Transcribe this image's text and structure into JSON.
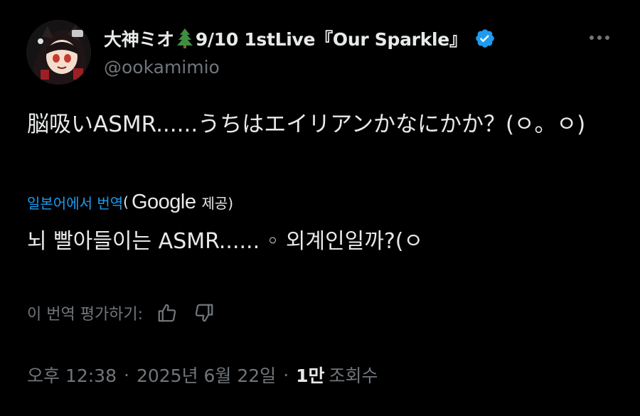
{
  "author": {
    "display_name_prefix": "大神ミオ",
    "tree_icon": "christmas-tree-icon",
    "display_name_suffix": "9/10 1stLive『Our Sparkle』",
    "verified_icon": "verified-badge-icon",
    "handle": "@ookamimio"
  },
  "more_icon": "more-horizontal-icon",
  "tweet": {
    "text": "脳吸いASMR......うちはエイリアンかなにかか？(ㅇ。ㅇ)"
  },
  "translation": {
    "link_label": "일본어에서 번역",
    "open_paren": "(",
    "provider": "Google",
    "provided_label": "제공)",
    "text": "뇌 빨아들이는 ASMR......  ◦  외계인일까?(ㅇ"
  },
  "rating": {
    "label": "이 번역 평가하기:",
    "like_icon": "thumbs-up-icon",
    "dislike_icon": "thumbs-down-icon"
  },
  "meta": {
    "time": "오후 12:38",
    "separator": "·",
    "date": "2025년 6월 22일",
    "views_count": "1만",
    "views_label": "조회수"
  },
  "colors": {
    "background": "#000000",
    "text": "#e7e9ea",
    "muted": "#71767b",
    "accent": "#1d9bf0"
  }
}
